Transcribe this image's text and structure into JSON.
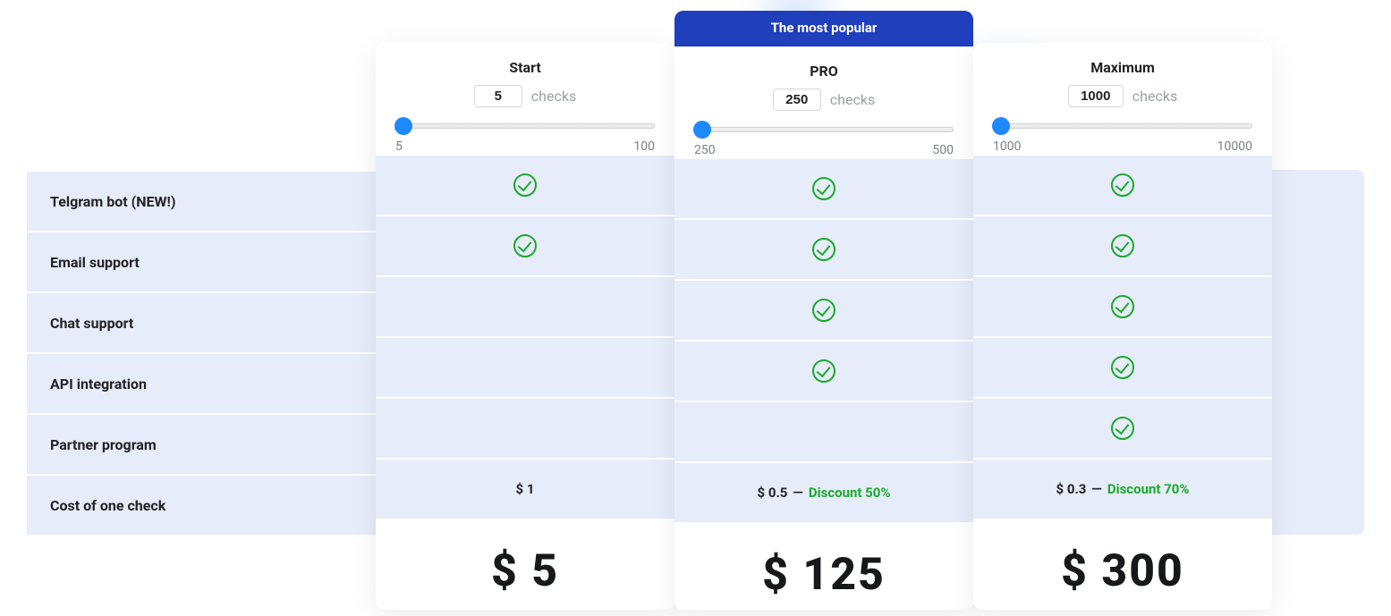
{
  "popular_label": "The most popular",
  "checks_label": "checks",
  "plans": {
    "start": {
      "name": "Start",
      "value": "5",
      "min": "5",
      "max": "100",
      "price": "$ 5",
      "cost": "$ 1"
    },
    "pro": {
      "name": "PRO",
      "value": "250",
      "min": "250",
      "max": "500",
      "price": "$ 125",
      "cost": "$ 0.5",
      "discount": "Discount 50%"
    },
    "max": {
      "name": "Maximum",
      "value": "1000",
      "min": "1000",
      "max": "10000",
      "price": "$ 300",
      "cost": "$ 0.3",
      "discount": "Discount 70%"
    }
  },
  "features": {
    "telegram": "Telgram bot (NEW!)",
    "email": "Email support",
    "chat": "Chat support",
    "api": "API integration",
    "partner": "Partner program",
    "cost": "Cost of one check"
  },
  "dash": "—"
}
